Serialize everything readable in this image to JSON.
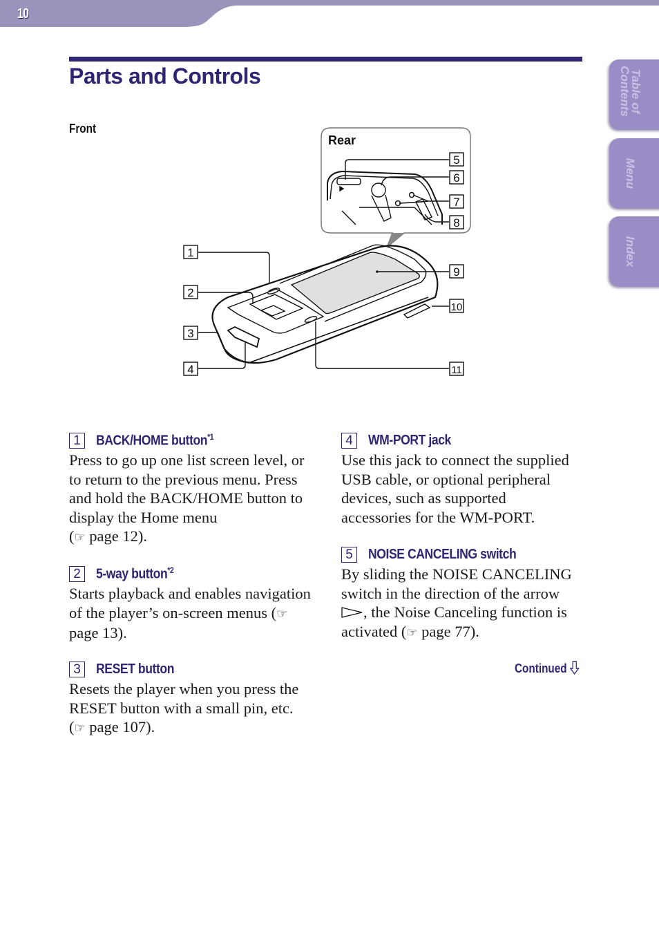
{
  "header": {
    "page_number": "10"
  },
  "side_tabs": [
    {
      "label": "Table of Contents",
      "line1": "Table of",
      "line2": "Contents"
    },
    {
      "label": "Menu"
    },
    {
      "label": "Index"
    }
  ],
  "title": "Parts and Controls",
  "diagram": {
    "front_label": "Front",
    "rear_label": "Rear",
    "callouts": [
      "1",
      "2",
      "3",
      "4",
      "5",
      "6",
      "7",
      "8",
      "9",
      "10",
      "11"
    ]
  },
  "items": [
    {
      "num": "1",
      "title": "BACK/HOME button",
      "footnote": "*1",
      "body": "Press to go up one list screen level, or to return to the previous menu. Press and hold the BACK/HOME button to display the Home menu",
      "ref": "page 12"
    },
    {
      "num": "2",
      "title": "5-way button",
      "footnote": "*2",
      "body": "Starts playback and enables navigation of the player’s on-screen menus",
      "ref": "page 13"
    },
    {
      "num": "3",
      "title": "RESET button",
      "footnote": "",
      "body": "Resets the player when you press the RESET button with a small pin, etc.",
      "ref": "page 107"
    },
    {
      "num": "4",
      "title": "WM-PORT jack",
      "footnote": "",
      "body": "Use this jack to connect the supplied USB cable, or optional peripheral devices, such as supported accessories for the WM-PORT.",
      "ref": ""
    },
    {
      "num": "5",
      "title": "NOISE CANCELING switch",
      "footnote": "",
      "body_pre": "By sliding the NOISE CANCELING switch in the direction of the arrow",
      "body_post": ", the Noise Canceling function is activated",
      "ref": "page 77"
    }
  ],
  "icons": {
    "reference": "pointing-hand-icon",
    "arrow": "right-triangle-outline-icon",
    "continued": "down-arrow-outline-icon"
  },
  "footer": {
    "continued": "Continued"
  },
  "colors": {
    "brand": "#2e2670",
    "band": "#9a93bb",
    "tab": "#9a8cc4"
  }
}
